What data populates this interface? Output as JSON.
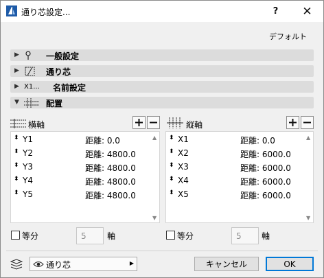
{
  "window": {
    "title": "通り芯設定...",
    "help_label": "?",
    "close_label": "✕"
  },
  "default_link": "デフォルト",
  "sections": [
    {
      "label": "一般設定",
      "icon": "pin-icon",
      "state": "collapsed"
    },
    {
      "label": "通り芯",
      "icon": "grid-line-icon",
      "state": "collapsed"
    },
    {
      "label": "名前設定",
      "icon": "naming-icon",
      "icon_text": "X1...",
      "state": "collapsed"
    },
    {
      "label": "配置",
      "icon": "placement-grid-icon",
      "state": "expanded"
    }
  ],
  "horizontal": {
    "label": "横軸",
    "add_label": "+",
    "remove_label": "−",
    "rows": [
      {
        "name": "Y1",
        "distance": "距離: 0.0"
      },
      {
        "name": "Y2",
        "distance": "距離: 4800.0"
      },
      {
        "name": "Y3",
        "distance": "距離: 4800.0"
      },
      {
        "name": "Y4",
        "distance": "距離: 4800.0"
      },
      {
        "name": "Y5",
        "distance": "距離: 4800.0"
      }
    ],
    "equal_label": "等分",
    "equal_checked": false,
    "count_value": "5",
    "axis_label": "軸"
  },
  "vertical": {
    "label": "縦軸",
    "add_label": "+",
    "remove_label": "−",
    "rows": [
      {
        "name": "X1",
        "distance": "距離: 0.0"
      },
      {
        "name": "X2",
        "distance": "距離: 6000.0"
      },
      {
        "name": "X3",
        "distance": "距離: 6000.0"
      },
      {
        "name": "X4",
        "distance": "距離: 6000.0"
      },
      {
        "name": "X5",
        "distance": "距離: 6000.0"
      }
    ],
    "equal_label": "等分",
    "equal_checked": false,
    "count_value": "5",
    "axis_label": "軸"
  },
  "footer": {
    "layer_value": "通り芯",
    "cancel_label": "キャンセル",
    "ok_label": "OK"
  },
  "colors": {
    "accent": "#0078d7",
    "section_bg": "#dcdcdc",
    "dialog_bg": "#f0f0f0"
  }
}
